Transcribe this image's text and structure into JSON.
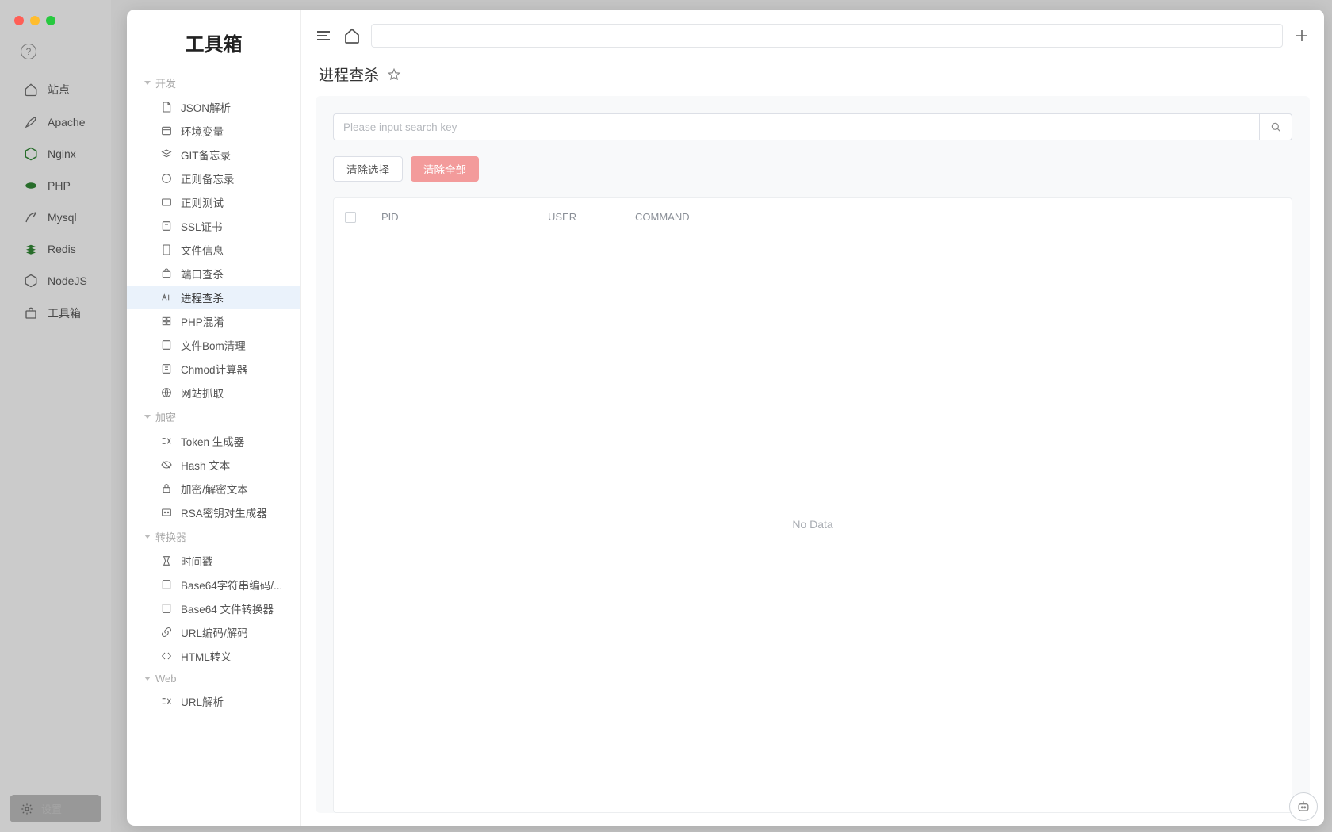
{
  "outer_sidebar": {
    "items": [
      {
        "label": "站点"
      },
      {
        "label": "Apache"
      },
      {
        "label": "Nginx"
      },
      {
        "label": "PHP"
      },
      {
        "label": "Mysql"
      },
      {
        "label": "Redis"
      },
      {
        "label": "NodeJS"
      },
      {
        "label": "工具箱"
      }
    ],
    "settings_label": "设置"
  },
  "tool_sidebar": {
    "title": "工具箱",
    "categories": [
      {
        "name": "开发",
        "items": [
          {
            "label": "JSON解析"
          },
          {
            "label": "环境变量"
          },
          {
            "label": "GIT备忘录"
          },
          {
            "label": "正则备忘录"
          },
          {
            "label": "正则测试"
          },
          {
            "label": "SSL证书"
          },
          {
            "label": "文件信息"
          },
          {
            "label": "端口查杀"
          },
          {
            "label": "进程查杀",
            "active": true
          },
          {
            "label": "PHP混淆"
          },
          {
            "label": "文件Bom清理"
          },
          {
            "label": "Chmod计算器"
          },
          {
            "label": "网站抓取"
          }
        ]
      },
      {
        "name": "加密",
        "items": [
          {
            "label": "Token 生成器"
          },
          {
            "label": "Hash 文本"
          },
          {
            "label": "加密/解密文本"
          },
          {
            "label": "RSA密钥对生成器"
          }
        ]
      },
      {
        "name": "转换器",
        "items": [
          {
            "label": "时间戳"
          },
          {
            "label": "Base64字符串编码/..."
          },
          {
            "label": "Base64 文件转换器"
          },
          {
            "label": "URL编码/解码"
          },
          {
            "label": "HTML转义"
          }
        ]
      },
      {
        "name": "Web",
        "items": [
          {
            "label": "URL解析"
          }
        ]
      }
    ]
  },
  "content": {
    "page_title": "进程查杀",
    "search_placeholder": "Please input search key",
    "clear_selection_label": "清除选择",
    "clear_all_label": "清除全部",
    "table": {
      "columns": {
        "pid": "PID",
        "user": "USER",
        "command": "COMMAND"
      },
      "rows": [],
      "empty_text": "No Data"
    }
  }
}
